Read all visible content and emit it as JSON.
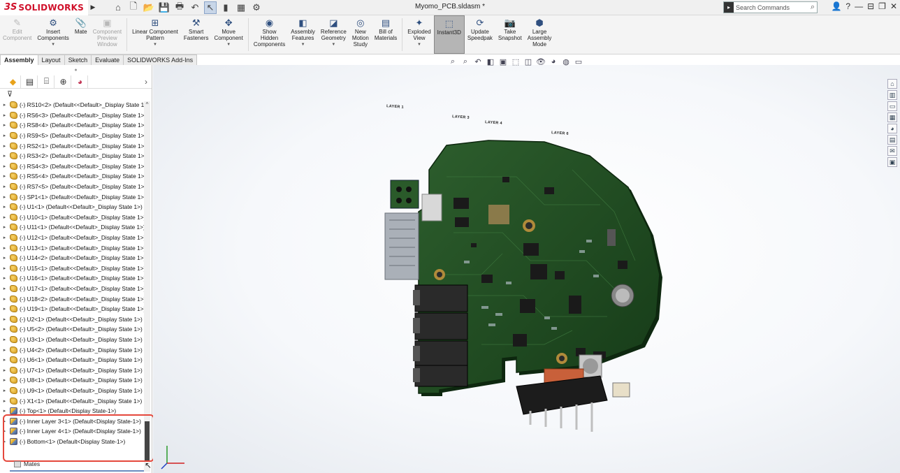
{
  "app": {
    "logo_ds": "3S",
    "logo_name": "SOLIDWORKS",
    "document_title": "Myomo_PCB.sldasm *",
    "search_placeholder": "Search Commands"
  },
  "commands": [
    {
      "label": "Edit Component",
      "icon": "edit-component-icon",
      "glyph": "✎",
      "disabled": true
    },
    {
      "label": "Insert Components",
      "icon": "insert-components-icon",
      "glyph": "⚙",
      "disabled": false,
      "dropdown": true
    },
    {
      "label": "Mate",
      "icon": "mate-icon",
      "glyph": "📎",
      "disabled": false
    },
    {
      "label": "Component Preview Window",
      "icon": "preview-window-icon",
      "glyph": "▣",
      "disabled": true
    },
    {
      "label": "Linear Component Pattern",
      "icon": "linear-pattern-icon",
      "glyph": "⊞",
      "disabled": false,
      "dropdown": true
    },
    {
      "label": "Smart Fasteners",
      "icon": "smart-fasteners-icon",
      "glyph": "⚒",
      "disabled": false
    },
    {
      "label": "Move Component",
      "icon": "move-component-icon",
      "glyph": "✥",
      "disabled": false,
      "dropdown": true
    },
    {
      "label": "Show Hidden Components",
      "icon": "show-hidden-icon",
      "glyph": "◉",
      "disabled": false
    },
    {
      "label": "Assembly Features",
      "icon": "assembly-features-icon",
      "glyph": "◧",
      "disabled": false,
      "dropdown": true
    },
    {
      "label": "Reference Geometry",
      "icon": "reference-geometry-icon",
      "glyph": "◪",
      "disabled": false,
      "dropdown": true
    },
    {
      "label": "New Motion Study",
      "icon": "motion-study-icon",
      "glyph": "◎",
      "disabled": false
    },
    {
      "label": "Bill of Materials",
      "icon": "bom-icon",
      "glyph": "▤",
      "disabled": false
    },
    {
      "label": "Exploded View",
      "icon": "exploded-view-icon",
      "glyph": "✦",
      "disabled": false,
      "dropdown": true
    },
    {
      "label": "Instant3D",
      "icon": "instant3d-icon",
      "glyph": "⬚",
      "disabled": false,
      "active": true
    },
    {
      "label": "Update Speedpak",
      "icon": "speedpak-icon",
      "glyph": "⟳",
      "disabled": false
    },
    {
      "label": "Take Snapshot",
      "icon": "snapshot-icon",
      "glyph": "📷",
      "disabled": false
    },
    {
      "label": "Large Assembly Mode",
      "icon": "large-assembly-icon",
      "glyph": "⬢",
      "disabled": false
    }
  ],
  "tabs": [
    "Assembly",
    "Layout",
    "Sketch",
    "Evaluate",
    "SOLIDWORKS Add-Ins"
  ],
  "tree_items": [
    {
      "text": "(-) RS10<2> (Default<<Default>_Display State 1",
      "type": "part"
    },
    {
      "text": "(-) RS6<3> (Default<<Default>_Display State 1>",
      "type": "part"
    },
    {
      "text": "(-) RS8<4> (Default<<Default>_Display State 1>",
      "type": "part"
    },
    {
      "text": "(-) RS9<5> (Default<<Default>_Display State 1>",
      "type": "part"
    },
    {
      "text": "(-) RS2<1> (Default<<Default>_Display State 1>",
      "type": "part"
    },
    {
      "text": "(-) RS3<2> (Default<<Default>_Display State 1>",
      "type": "part"
    },
    {
      "text": "(-) RS4<3> (Default<<Default>_Display State 1>",
      "type": "part"
    },
    {
      "text": "(-) RS5<4> (Default<<Default>_Display State 1>",
      "type": "part"
    },
    {
      "text": "(-) RS7<5> (Default<<Default>_Display State 1>",
      "type": "part"
    },
    {
      "text": "(-) SP1<1> (Default<<Default>_Display State 1>",
      "type": "part"
    },
    {
      "text": "(-) U1<1> (Default<<Default>_Display State 1>)",
      "type": "part"
    },
    {
      "text": "(-) U10<1> (Default<<Default>_Display State 1>)",
      "type": "part"
    },
    {
      "text": "(-) U11<1> (Default<<Default>_Display State 1>)",
      "type": "part"
    },
    {
      "text": "(-) U12<1> (Default<<Default>_Display State 1>)",
      "type": "part"
    },
    {
      "text": "(-) U13<1> (Default<<Default>_Display State 1>)",
      "type": "part"
    },
    {
      "text": "(-) U14<2> (Default<<Default>_Display State 1>)",
      "type": "part"
    },
    {
      "text": "(-) U15<1> (Default<<Default>_Display State 1>)",
      "type": "part"
    },
    {
      "text": "(-) U16<1> (Default<<Default>_Display State 1>)",
      "type": "part"
    },
    {
      "text": "(-) U17<1> (Default<<Default>_Display State 1>)",
      "type": "part"
    },
    {
      "text": "(-) U18<2> (Default<<Default>_Display State 1>)",
      "type": "part"
    },
    {
      "text": "(-) U19<1> (Default<<Default>_Display State 1>)",
      "type": "part"
    },
    {
      "text": "(-) U2<1> (Default<<Default>_Display State 1>)",
      "type": "part"
    },
    {
      "text": "(-) U5<2> (Default<<Default>_Display State 1>)",
      "type": "part"
    },
    {
      "text": "(-) U3<1> (Default<<Default>_Display State 1>)",
      "type": "part"
    },
    {
      "text": "(-) U4<2> (Default<<Default>_Display State 1>)",
      "type": "part"
    },
    {
      "text": "(-) U6<1> (Default<<Default>_Display State 1>)",
      "type": "part"
    },
    {
      "text": "(-) U7<1> (Default<<Default>_Display State 1>)",
      "type": "part"
    },
    {
      "text": "(-) U8<1> (Default<<Default>_Display State 1>)",
      "type": "part"
    },
    {
      "text": "(-) U9<1> (Default<<Default>_Display State 1>)",
      "type": "part"
    },
    {
      "text": "(-) X1<1> (Default<<Default>_Display State 1>)",
      "type": "part"
    },
    {
      "text": "(-) Top<1> (Default<Display State-1>)",
      "type": "sub"
    },
    {
      "text": "(-) Inner Layer 3<1> (Default<Display State-1>)",
      "type": "sub"
    },
    {
      "text": "(-) Inner Layer 4<1> (Default<Display State-1>)",
      "type": "sub"
    },
    {
      "text": "(-) Bottom<1> (Default<Display State-1>)",
      "type": "sub"
    }
  ],
  "mates_label": "Mates",
  "layer_labels": [
    "LAYER 1",
    "LAYER 3",
    "LAYER 4",
    "LAYER 6"
  ],
  "colors": {
    "highlight": "#e5483c",
    "pcb": "#1f4a22",
    "accent": "#d0102a"
  }
}
